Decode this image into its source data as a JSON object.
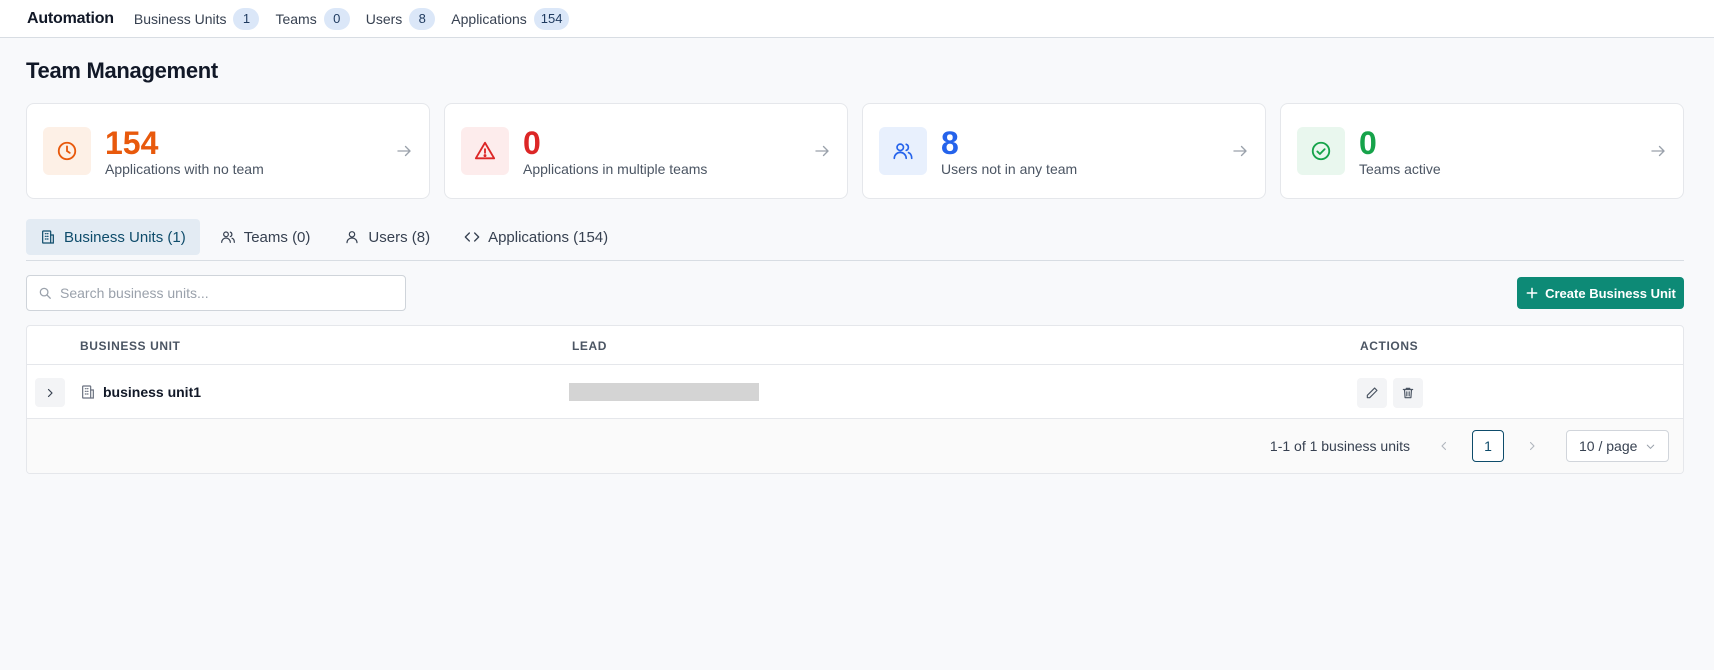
{
  "topbar": {
    "brand": "Automation",
    "nav": [
      {
        "label": "Business Units",
        "count": "1"
      },
      {
        "label": "Teams",
        "count": "0"
      },
      {
        "label": "Users",
        "count": "8"
      },
      {
        "label": "Applications",
        "count": "154"
      }
    ]
  },
  "page": {
    "title": "Team Management"
  },
  "cards": [
    {
      "value": "154",
      "label": "Applications with no team",
      "icon": "clock-icon",
      "color": "#e8590c",
      "bg": "#fdf0e6"
    },
    {
      "value": "0",
      "label": "Applications in multiple teams",
      "icon": "warning-icon",
      "color": "#dc2626",
      "bg": "#fdecec"
    },
    {
      "value": "8",
      "label": "Users not in any team",
      "icon": "users-icon",
      "color": "#2563eb",
      "bg": "#e8f0fd"
    },
    {
      "value": "0",
      "label": "Teams active",
      "icon": "check-circle-icon",
      "color": "#16a34a",
      "bg": "#e9f7ee"
    }
  ],
  "tabs": [
    {
      "label": "Business Units (1)",
      "icon": "building-icon",
      "active": true
    },
    {
      "label": "Teams (0)",
      "icon": "users-icon",
      "active": false
    },
    {
      "label": "Users (8)",
      "icon": "user-icon",
      "active": false
    },
    {
      "label": "Applications (154)",
      "icon": "code-icon",
      "active": false
    }
  ],
  "search": {
    "placeholder": "Search business units...",
    "value": ""
  },
  "create_button": {
    "label": "Create Business Unit"
  },
  "table": {
    "columns": [
      "BUSINESS UNIT",
      "LEAD",
      "ACTIONS"
    ],
    "rows": [
      {
        "name": "business unit1",
        "lead": ""
      }
    ]
  },
  "pagination": {
    "summary": "1-1 of 1 business units",
    "current_page": "1",
    "page_size": "10 / page"
  },
  "colors": {
    "accent": "#0d8a76",
    "tab_active": "#0e4c6b"
  }
}
